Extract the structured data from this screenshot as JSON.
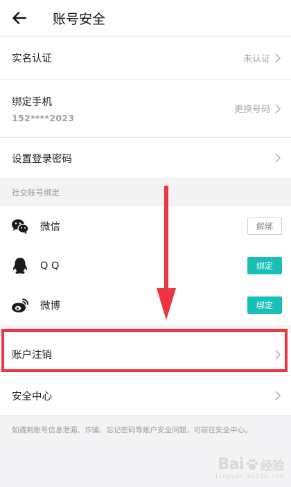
{
  "header": {
    "title": "账号安全",
    "back_icon": "arrow-left-icon"
  },
  "account": {
    "real_name": {
      "label": "实名认证",
      "value": "未认证"
    },
    "phone": {
      "label": "绑定手机",
      "number": "152****2023",
      "action": "更换号码"
    },
    "password": {
      "label": "设置登录密码"
    }
  },
  "social": {
    "section_title": "社交账号绑定",
    "items": [
      {
        "name": "微信",
        "icon": "wechat-icon",
        "button": "解绑",
        "status": "bound"
      },
      {
        "name": "Q Q",
        "icon": "qq-icon",
        "button": "绑定",
        "status": "unbound"
      },
      {
        "name": "微博",
        "icon": "weibo-icon",
        "button": "绑定",
        "status": "unbound"
      }
    ]
  },
  "cancel_account": {
    "label": "账户注销"
  },
  "security_center": {
    "label": "安全中心"
  },
  "footer_note": "如遇到账号信息泄漏、诈骗、忘记密码等账户安全问题，可前往安全中心。",
  "watermark": {
    "brand_latin": "Bai",
    "brand_cn": "经验",
    "url": "jingyan.baidu.com"
  },
  "colors": {
    "accent": "#17c0b5",
    "highlight": "#ee3341",
    "background": "#f3f3f5"
  }
}
